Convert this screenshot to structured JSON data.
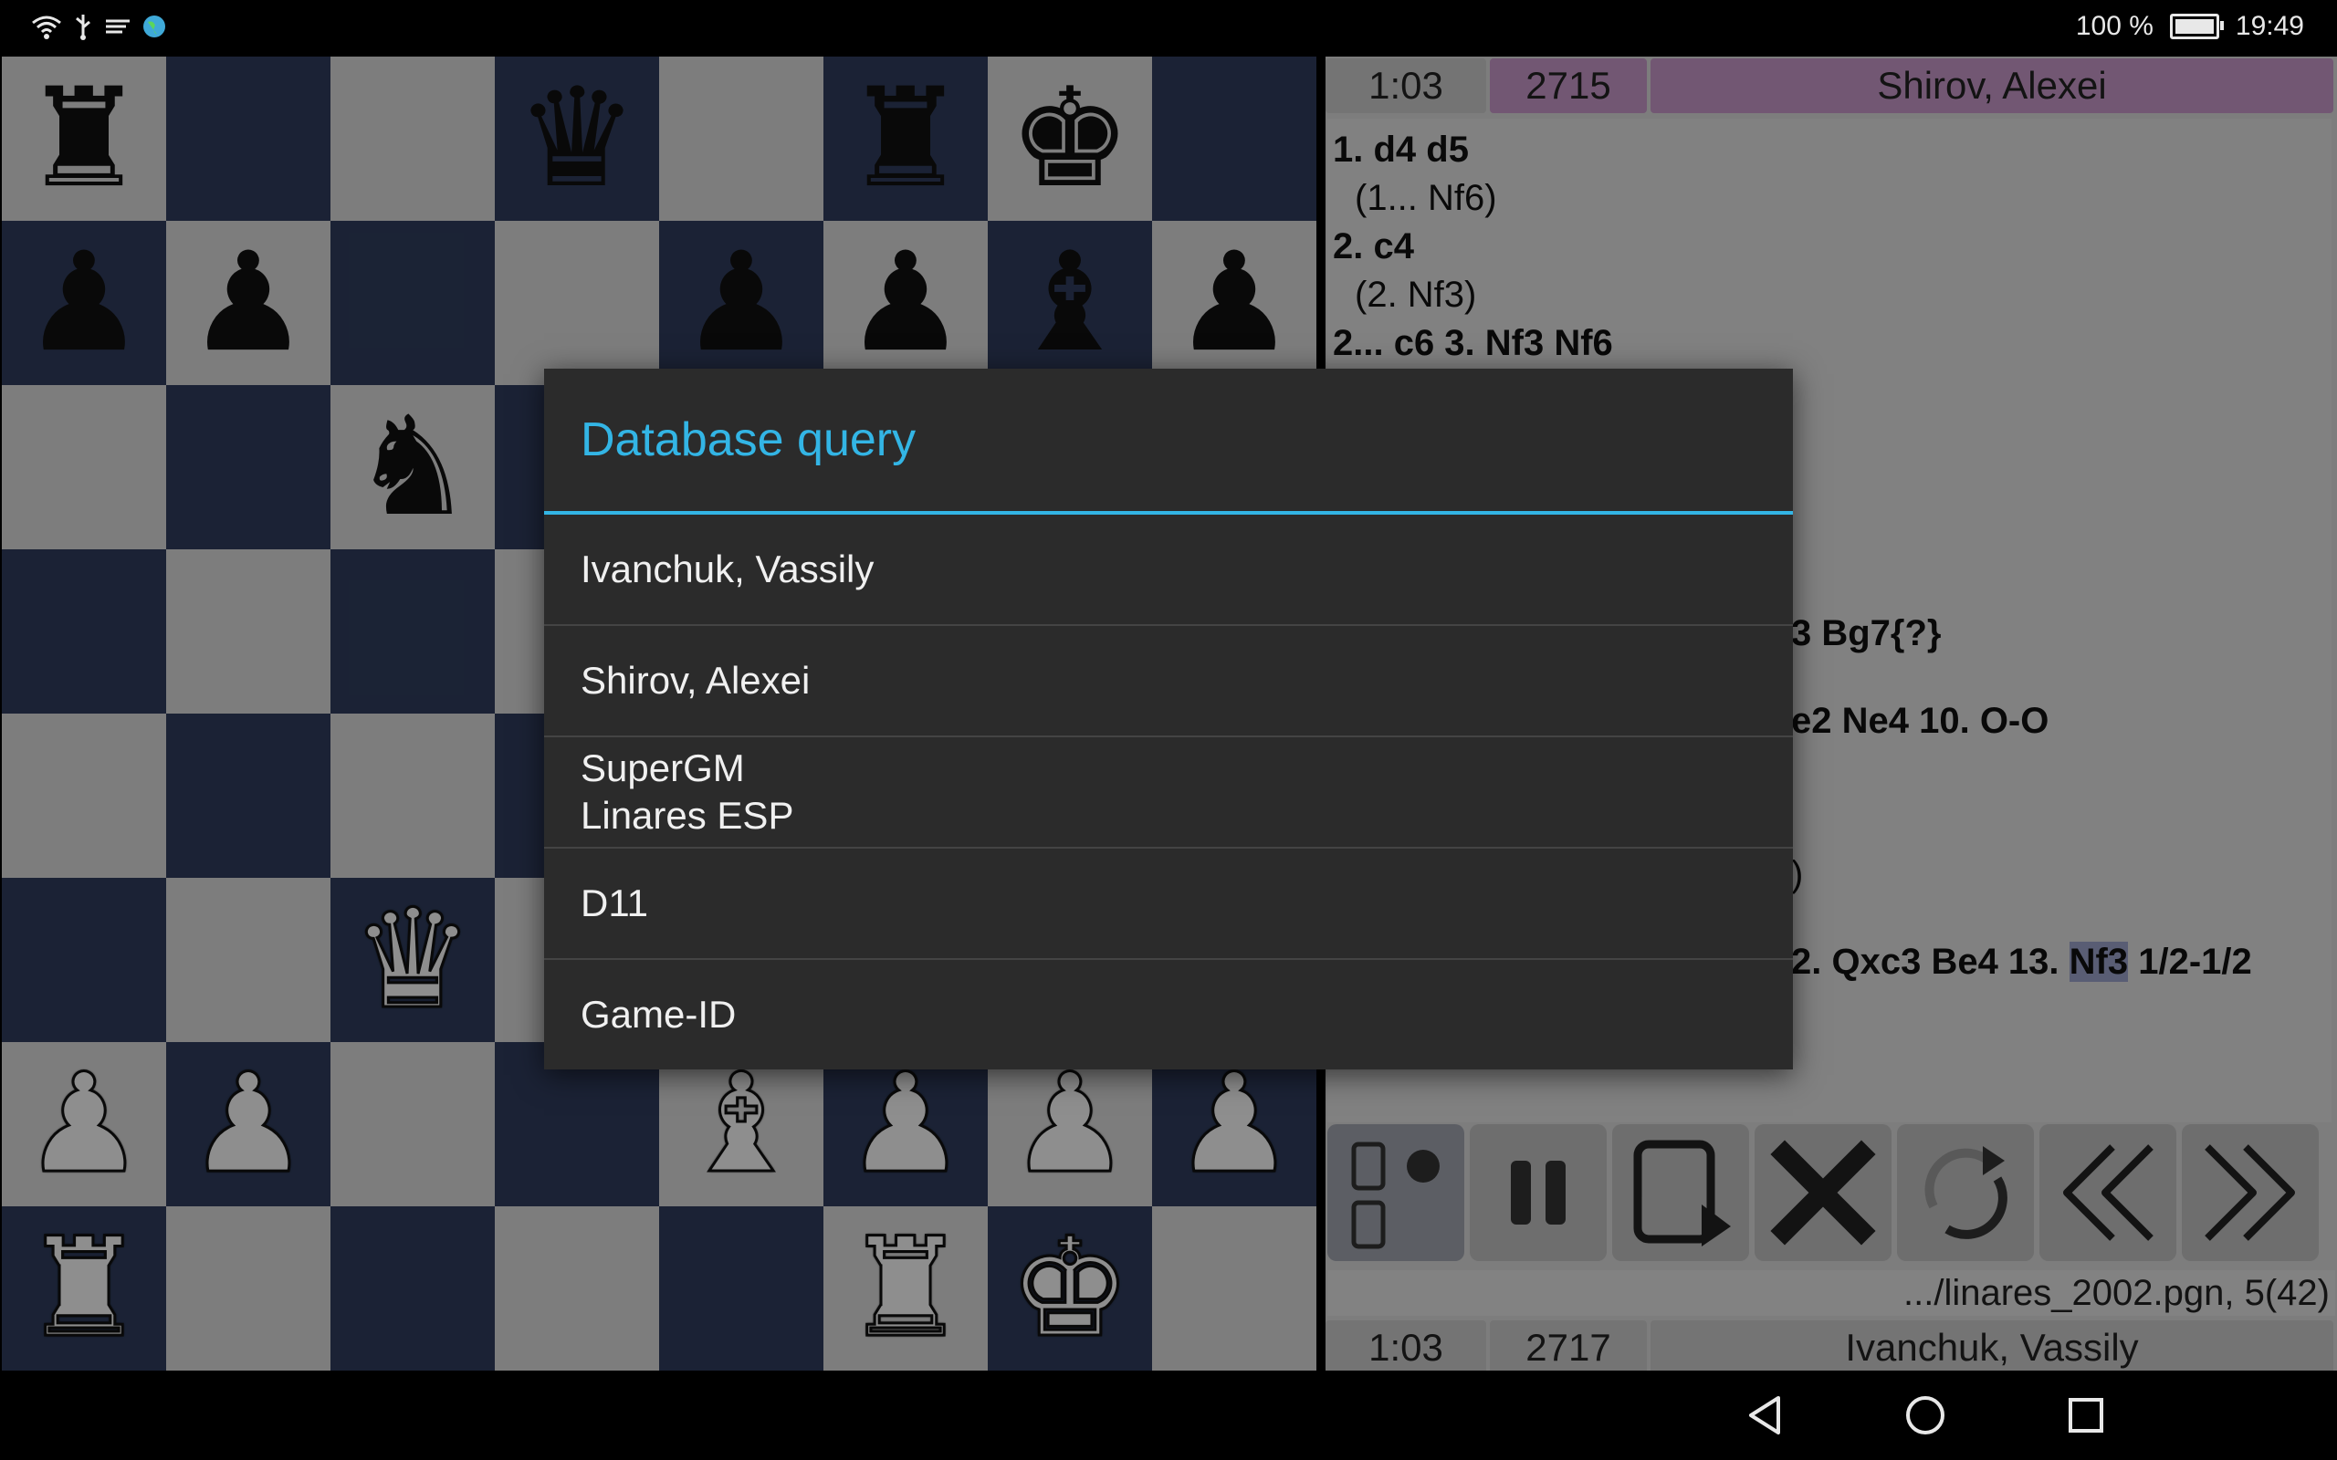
{
  "status_bar": {
    "icons": [
      "wifi-icon",
      "usb-icon",
      "cast-icon",
      "globe-icon"
    ],
    "battery_text": "100 %",
    "time": "19:49"
  },
  "board": {
    "rows": [
      [
        "bR",
        "",
        "",
        "bQ",
        "",
        "bR",
        "bK",
        ""
      ],
      [
        "bP",
        "bP",
        "",
        "",
        "bP",
        "bP",
        "bB",
        "bP"
      ],
      [
        "",
        "",
        "bN",
        "",
        "",
        "",
        "",
        ""
      ],
      [
        "",
        "",
        "",
        "",
        "",
        "",
        "",
        ""
      ],
      [
        "",
        "",
        "",
        "",
        "",
        "",
        "",
        ""
      ],
      [
        "",
        "",
        "wQ",
        "",
        "",
        "",
        "",
        ""
      ],
      [
        "wP",
        "wP",
        "",
        "",
        "wB",
        "wP",
        "wP",
        "wP"
      ],
      [
        "wR",
        "",
        "",
        "",
        "",
        "wR",
        "wK",
        ""
      ]
    ]
  },
  "top_player": {
    "clock": "1:03",
    "elo": "2715",
    "name": "Shirov, Alexei"
  },
  "bottom_player": {
    "clock": "1:03",
    "elo": "2717",
    "name": "Ivanchuk, Vassily"
  },
  "moves": {
    "line1": "1. d4 d5",
    "line2": "(1... Nf6)",
    "line3": "2. c4",
    "line4": "(2. Nf3)",
    "line5": "2... c6 3. Nf3 Nf6",
    "frag1": "3 Bg7{?}",
    "frag2": "e2 Ne4 10. O-O",
    "frag3": ")",
    "frag4a": "2. Qxc3 Be4 13.",
    "frag4_highlight": "Nf3",
    "frag4b": "1/2-1/2"
  },
  "file_info": ".../linares_2002.pgn, 5(42)",
  "dialog": {
    "title": "Database query",
    "items": [
      {
        "label": "Ivanchuk, Vassily"
      },
      {
        "label": "Shirov, Alexei"
      },
      {
        "line1": "SuperGM",
        "line2": "Linares ESP"
      },
      {
        "label": "D11"
      },
      {
        "label": "Game-ID"
      }
    ]
  },
  "colors": {
    "accent": "#33b5e5",
    "board_dark": "#2f3c5c",
    "board_light": "#d8d8d8",
    "player_highlight": "#c496c7"
  }
}
